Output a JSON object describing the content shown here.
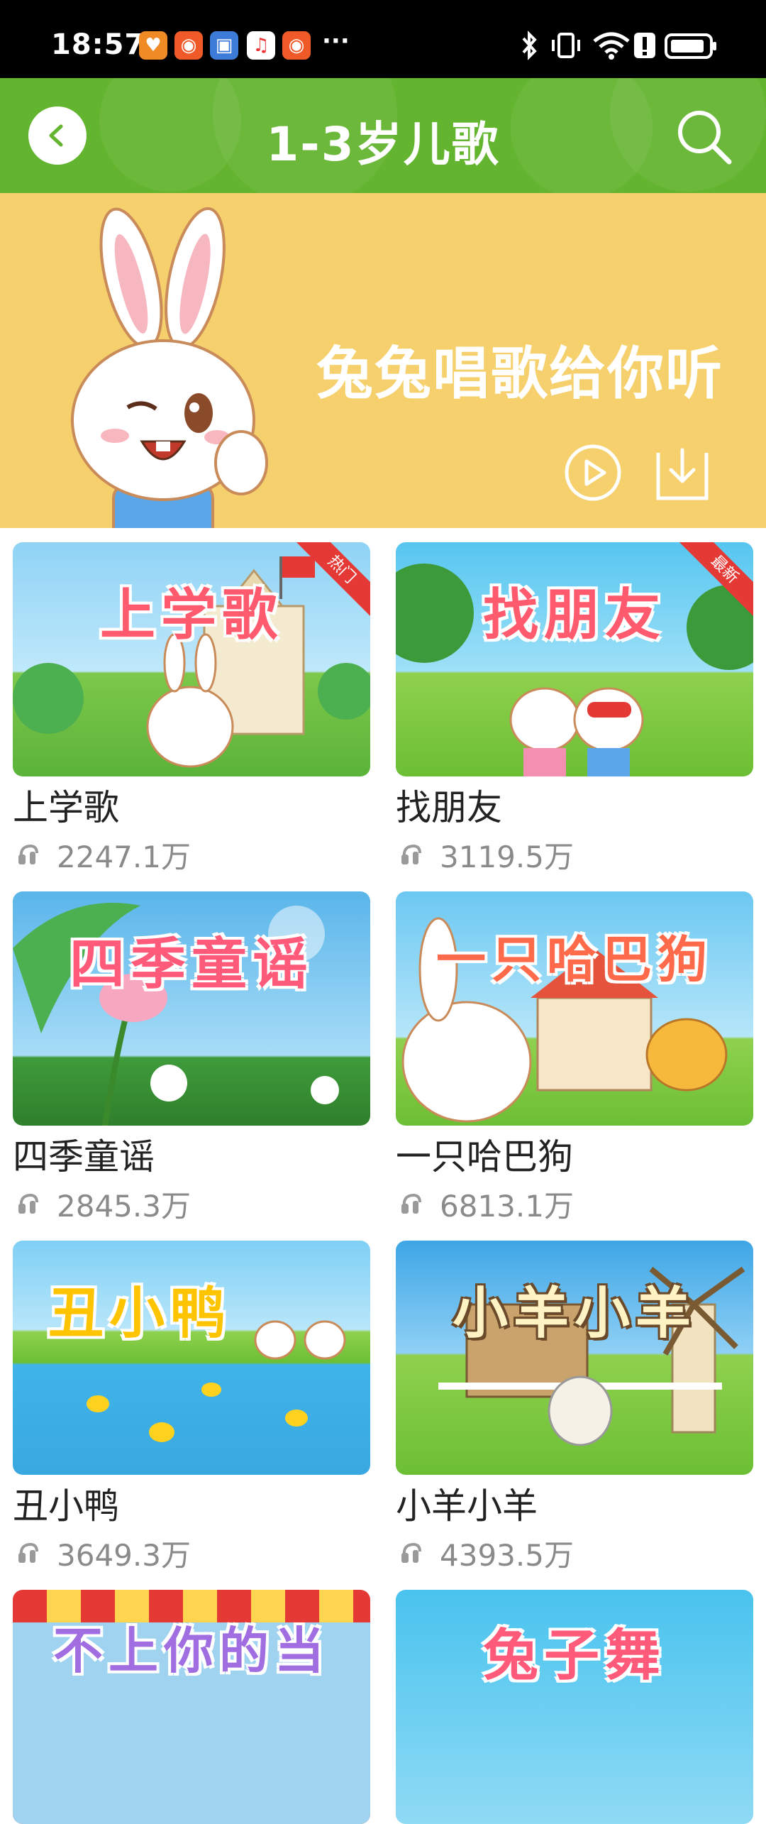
{
  "status_bar": {
    "time": "18:57",
    "more": "···",
    "icons": [
      "heart-app-icon",
      "kuaishou-icon",
      "app-icon",
      "music-icon",
      "kuaishou-icon",
      "bluetooth-icon",
      "vibrate-icon",
      "wifi-icon",
      "alert-icon",
      "battery-icon"
    ]
  },
  "header": {
    "title": "1-3岁儿歌",
    "back_icon": "back-icon",
    "search_icon": "search-icon",
    "color": "#63b42f"
  },
  "banner": {
    "title": "兔兔唱歌给你听",
    "color": "#f5d06c",
    "play_icon": "play-icon",
    "download_icon": "download-icon"
  },
  "songs": [
    {
      "title": "上学歌",
      "thumb_text": "上学歌",
      "plays": "2247.1万",
      "tag": "热门"
    },
    {
      "title": "找朋友",
      "thumb_text": "找朋友",
      "plays": "3119.5万",
      "tag": "最新"
    },
    {
      "title": "四季童谣",
      "thumb_text": "四季童谣",
      "plays": "2845.3万",
      "tag": ""
    },
    {
      "title": "一只哈巴狗",
      "thumb_text": "一只哈巴狗",
      "plays": "6813.1万",
      "tag": ""
    },
    {
      "title": "丑小鸭",
      "thumb_text": "丑小鸭",
      "plays": "3649.3万",
      "tag": ""
    },
    {
      "title": "小羊小羊",
      "thumb_text": "小羊小羊",
      "plays": "4393.5万",
      "tag": ""
    },
    {
      "title": "",
      "thumb_text": "不上你的当",
      "plays": "",
      "tag": ""
    },
    {
      "title": "",
      "thumb_text": "兔子舞",
      "plays": "",
      "tag": ""
    }
  ]
}
